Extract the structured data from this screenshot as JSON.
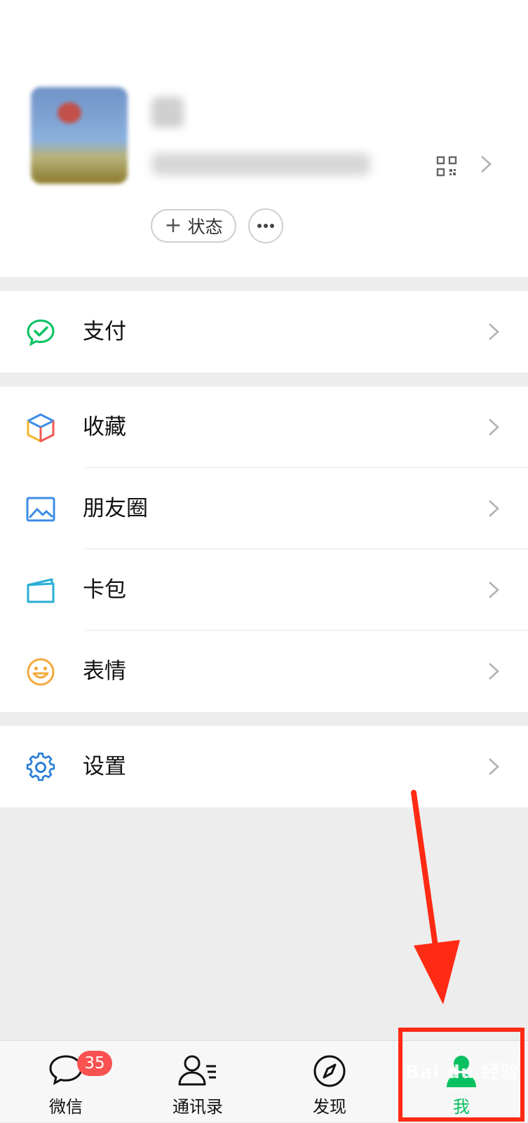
{
  "profile": {
    "status_label": "状态",
    "status_plus": "+",
    "more_label": "···"
  },
  "menu": {
    "group1": [
      {
        "label": "支付",
        "icon": "wechat-pay-icon"
      }
    ],
    "group2": [
      {
        "label": "收藏",
        "icon": "favorites-cube-icon"
      },
      {
        "label": "朋友圈",
        "icon": "moments-image-icon"
      },
      {
        "label": "卡包",
        "icon": "card-wallet-icon"
      },
      {
        "label": "表情",
        "icon": "smiley-icon"
      }
    ],
    "group3": [
      {
        "label": "设置",
        "icon": "gear-icon"
      }
    ]
  },
  "tabbar": {
    "tabs": [
      {
        "label": "微信",
        "icon": "chat-bubble-icon",
        "badge": "35"
      },
      {
        "label": "通讯录",
        "icon": "contacts-icon"
      },
      {
        "label": "发现",
        "icon": "compass-icon"
      },
      {
        "label": "我",
        "icon": "person-icon",
        "active": true
      }
    ]
  },
  "watermark": "Bai du 经验",
  "colors": {
    "accent": "#07c160",
    "badge": "#fa5151",
    "annotation": "#ff2a14",
    "background": "#ededed"
  }
}
